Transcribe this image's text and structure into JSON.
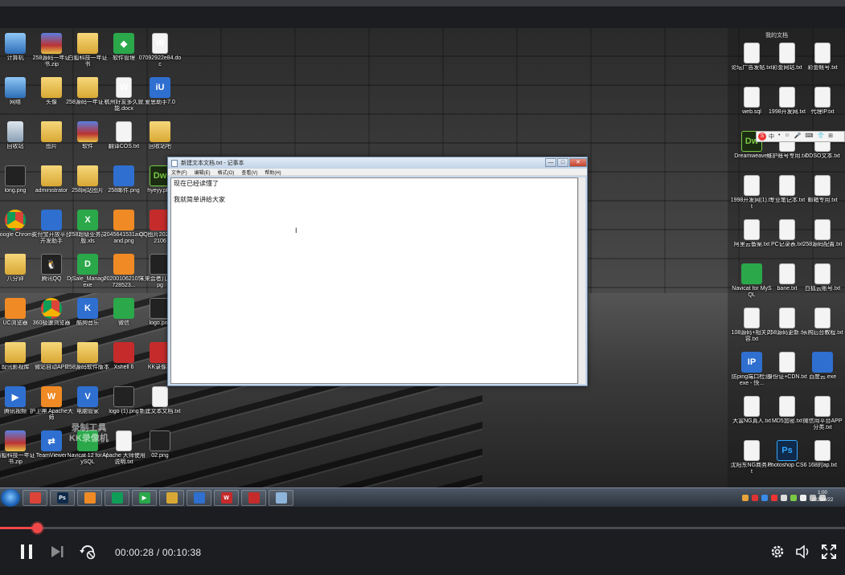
{
  "video": {
    "desktop": {
      "left_icons": [
        {
          "label": "计算机",
          "kind": "pc",
          "glyph": ""
        },
        {
          "label": "258源码一年证书.zip",
          "kind": "winrar",
          "glyph": ""
        },
        {
          "label": "白狐科技一年证书",
          "kind": "folder",
          "glyph": ""
        },
        {
          "label": "软件管理",
          "kind": "green",
          "glyph": "◆"
        },
        {
          "label": "07092922e84.doc",
          "kind": "doc",
          "glyph": "W"
        },
        {
          "label": "网络",
          "kind": "pc",
          "glyph": ""
        },
        {
          "label": "头像",
          "kind": "folder",
          "glyph": ""
        },
        {
          "label": "258源码一年证书",
          "kind": "folder",
          "glyph": ""
        },
        {
          "label": "杭州好友多久就能.docx",
          "kind": "doc",
          "glyph": "W"
        },
        {
          "label": "爱思助手7.0",
          "kind": "blue",
          "glyph": "iU"
        },
        {
          "label": "回收站",
          "kind": "trash",
          "glyph": ""
        },
        {
          "label": "图片",
          "kind": "folder",
          "glyph": ""
        },
        {
          "label": "软件",
          "kind": "winrar",
          "glyph": ""
        },
        {
          "label": "翻译COS.txt",
          "kind": "doc",
          "glyph": ""
        },
        {
          "label": "回收站吧",
          "kind": "folder",
          "glyph": ""
        },
        {
          "label": "long.png",
          "kind": "dark",
          "glyph": ""
        },
        {
          "label": "administrator",
          "kind": "folder",
          "glyph": ""
        },
        {
          "label": "258网站图片",
          "kind": "folder",
          "glyph": ""
        },
        {
          "label": "258邮件.png",
          "kind": "blue",
          "glyph": ""
        },
        {
          "label": "hyeyy.php",
          "kind": "dw",
          "glyph": "Dw"
        },
        {
          "label": "Google Chrome",
          "kind": "chrome",
          "glyph": ""
        },
        {
          "label": "支付宝开放平台开发助手",
          "kind": "blue",
          "glyph": ""
        },
        {
          "label": "258超级业务员版.xls",
          "kind": "green",
          "glyph": "X"
        },
        {
          "label": "2045641531asdand.png",
          "kind": "orange",
          "glyph": ""
        },
        {
          "label": "QQ图片20204172106",
          "kind": "red",
          "glyph": ""
        },
        {
          "label": "八分钟",
          "kind": "folder",
          "glyph": ""
        },
        {
          "label": "腾讯QQ",
          "kind": "dark",
          "glyph": "🐧"
        },
        {
          "label": "DjSale_Manage.exe",
          "kind": "green",
          "glyph": "D"
        },
        {
          "label": "2020010621051728523...",
          "kind": "orange",
          "glyph": ""
        },
        {
          "label": "未来会者几年文.jpg",
          "kind": "dark",
          "glyph": ""
        },
        {
          "label": "UC浏览器",
          "kind": "orange",
          "glyph": ""
        },
        {
          "label": "360极速浏览器",
          "kind": "chrome",
          "glyph": ""
        },
        {
          "label": "酷狗音乐",
          "kind": "blue",
          "glyph": "K"
        },
        {
          "label": "微信",
          "kind": "green",
          "glyph": ""
        },
        {
          "label": "logo.png",
          "kind": "dark",
          "glyph": ""
        },
        {
          "label": "现讯影视库",
          "kind": "folder",
          "glyph": ""
        },
        {
          "label": "微站自动APP",
          "kind": "folder",
          "glyph": ""
        },
        {
          "label": "258源码软件版本",
          "kind": "folder",
          "glyph": ""
        },
        {
          "label": "Xshell 6",
          "kind": "red",
          "glyph": ""
        },
        {
          "label": "KK录像机",
          "kind": "red",
          "glyph": ""
        },
        {
          "label": "腾讯视频",
          "kind": "blue",
          "glyph": "▶"
        },
        {
          "label": "护卫神 Apache大师",
          "kind": "orange",
          "glyph": "W"
        },
        {
          "label": "电脑管家",
          "kind": "blue",
          "glyph": "V"
        },
        {
          "label": "logo (1).png",
          "kind": "dark",
          "glyph": ""
        },
        {
          "label": "新建文本文档.txt",
          "kind": "doc",
          "glyph": ""
        },
        {
          "label": "白狐科技一年证书.zip",
          "kind": "winrar",
          "glyph": ""
        },
        {
          "label": "TeamViewer",
          "kind": "blue",
          "glyph": "⇄"
        },
        {
          "label": "Navicat 12 for MySQL",
          "kind": "green",
          "glyph": ""
        },
        {
          "label": "Apache 大师使用说明.txt",
          "kind": "doc",
          "glyph": ""
        },
        {
          "label": "02.png",
          "kind": "dark",
          "glyph": ""
        }
      ],
      "right_header": "我的文档",
      "right_icons": [
        {
          "label": "论坛广告发帖.txt",
          "kind": "doc",
          "glyph": ""
        },
        {
          "label": "彩金网站.txt",
          "kind": "doc",
          "glyph": ""
        },
        {
          "label": "彩金帐号.txt",
          "kind": "doc",
          "glyph": ""
        },
        {
          "label": "web.sql",
          "kind": "doc",
          "glyph": ""
        },
        {
          "label": "1998开发网.txt",
          "kind": "doc",
          "glyph": ""
        },
        {
          "label": "代理IP.txt",
          "kind": "doc",
          "glyph": ""
        },
        {
          "label": "Dreamweaver",
          "kind": "dw",
          "glyph": "Dw"
        },
        {
          "label": "维护账号专用.txt",
          "kind": "doc",
          "glyph": ""
        },
        {
          "label": "DDSO文本.txt",
          "kind": "doc",
          "glyph": ""
        },
        {
          "label": "1998开发网(1).txt",
          "kind": "doc",
          "glyph": ""
        },
        {
          "label": "专业笔记本.txt",
          "kind": "doc",
          "glyph": ""
        },
        {
          "label": "邮箱专用.txt",
          "kind": "doc",
          "glyph": ""
        },
        {
          "label": "阿里云备案.txt",
          "kind": "doc",
          "glyph": ""
        },
        {
          "label": "PC记录表.txt",
          "kind": "doc",
          "glyph": ""
        },
        {
          "label": "258源码配置.txt",
          "kind": "doc",
          "glyph": ""
        },
        {
          "label": "Navicat for MySQL",
          "kind": "green",
          "glyph": ""
        },
        {
          "label": "bane.txt",
          "kind": "doc",
          "glyph": ""
        },
        {
          "label": "白狐云账号.txt",
          "kind": "doc",
          "glyph": ""
        },
        {
          "label": "108源码+相关内容.txt",
          "kind": "doc",
          "glyph": ""
        },
        {
          "label": "258源码更新.txt",
          "kind": "doc",
          "glyph": ""
        },
        {
          "label": "乐购后台教程.txt",
          "kind": "doc",
          "glyph": ""
        },
        {
          "label": "防ping端口检测.exe - 快...",
          "kind": "blue",
          "glyph": "IP"
        },
        {
          "label": "身份证+CDN.txt",
          "kind": "doc",
          "glyph": ""
        },
        {
          "label": "百度云.exe",
          "kind": "blue",
          "glyph": ""
        },
        {
          "label": "大富NG真人.txt",
          "kind": "doc",
          "glyph": ""
        },
        {
          "label": "MD5加密.txt",
          "kind": "doc",
          "glyph": ""
        },
        {
          "label": "微信用平台APP分类.txt",
          "kind": "doc",
          "glyph": ""
        },
        {
          "label": "沈阳东NG商务.txt",
          "kind": "doc",
          "glyph": ""
        },
        {
          "label": "Photoshop CS6",
          "kind": "ps",
          "glyph": "Ps"
        },
        {
          "label": "168的ap.txt",
          "kind": "doc",
          "glyph": ""
        }
      ],
      "ime_bar": {
        "logo": "S",
        "items": [
          "中",
          "•",
          "☺",
          "🎤",
          "⌨",
          "👕",
          "⊞"
        ]
      }
    },
    "notepad": {
      "title": "新建文本文档.txt - 记事本",
      "window_buttons": [
        "—",
        "□",
        "✕"
      ],
      "menu": [
        "文件(F)",
        "编辑(E)",
        "格式(O)",
        "查看(V)",
        "帮助(H)"
      ],
      "lines": [
        "现在已经读懂了",
        "",
        "我就简单讲给大家"
      ]
    },
    "watermark": {
      "line1": "录制工具",
      "line2": "KK录像机"
    },
    "taskbar": {
      "items": [
        {
          "name": "chrome",
          "color": "#db4437",
          "glyph": ""
        },
        {
          "name": "photoshop",
          "color": "#0f2a4a",
          "glyph": "Ps"
        },
        {
          "name": "uc-browser",
          "color": "#f08a24",
          "glyph": ""
        },
        {
          "name": "chrome-2",
          "color": "#0f9d58",
          "glyph": ""
        },
        {
          "name": "video-player",
          "color": "#2aa84a",
          "glyph": "▶"
        },
        {
          "name": "explorer",
          "color": "#d9a834",
          "glyph": ""
        },
        {
          "name": "baidu-cloud",
          "color": "#2f6fd0",
          "glyph": ""
        },
        {
          "name": "apache-guard",
          "color": "#c62b2b",
          "glyph": "W"
        },
        {
          "name": "kk-recorder",
          "color": "#c62b2b",
          "glyph": ""
        },
        {
          "name": "notepad",
          "color": "#8fb4d9",
          "glyph": ""
        }
      ],
      "clock_time": "1:00",
      "clock_date": "2020/4/22"
    }
  },
  "player": {
    "current_time": "00:00:28",
    "total_time": "00:10:38",
    "time_separator": " / ",
    "progress_fraction": 0.044,
    "accent": "#f04848",
    "buttons": [
      "pause",
      "next",
      "loop-off",
      "settings",
      "volume",
      "fullscreen"
    ]
  }
}
